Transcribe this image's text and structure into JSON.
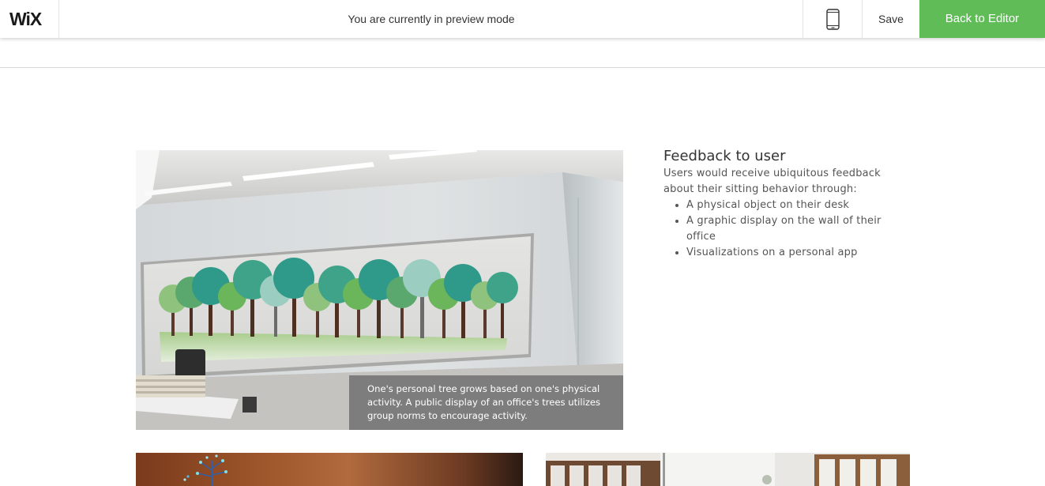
{
  "preview_bar": {
    "logo": "WiX",
    "message": "You are currently in preview mode",
    "mobile_icon": "mobile-phone-icon",
    "save_label": "Save",
    "back_label": "Back to Editor",
    "accent_color": "#60bc57"
  },
  "content": {
    "image_caption": "One's personal tree grows based on one's physical activity. A public display of an office's trees utilizes group norms to encourage activity.",
    "feedback": {
      "title": "Feedback to user",
      "description": "Users would receive ubiquitous feedback about their sitting behavior through:",
      "items": [
        "A physical object on their desk",
        "A graphic display on the wall of their office",
        "Visualizations on a personal app"
      ]
    }
  }
}
